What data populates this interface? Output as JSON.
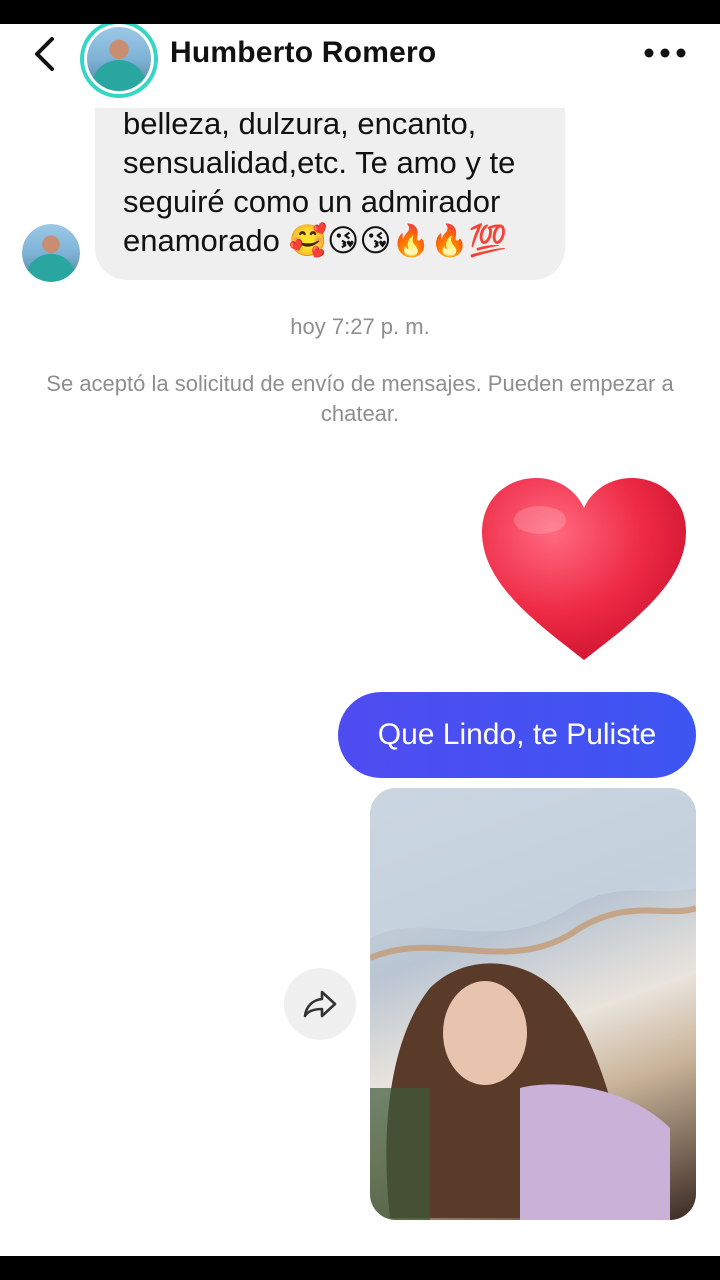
{
  "header": {
    "contact_name": "Humberto Romero"
  },
  "incoming_message": {
    "text": "belleza, dulzura, encanto,\nsensualidad,etc. Te amo y te\nseguiré como un admirador\nenamorado 🥰😘😘🔥🔥💯"
  },
  "timestamp": "hoy 7:27 p. m.",
  "system_message": "Se aceptó la solicitud de envío de mensajes. Pueden empezar a chatear.",
  "outgoing_message": {
    "text": "Que Lindo, te Puliste"
  },
  "icons": {
    "back": "chevron-left-icon",
    "more": "more-horizontal-icon",
    "share": "share-arrow-icon",
    "heart": "heart-emoji-icon"
  },
  "colors": {
    "outgoing_bubble": "#4f4cf0",
    "incoming_bubble": "#efefef",
    "avatar_ring": "#35d6c5",
    "heart": "#e8233e"
  }
}
